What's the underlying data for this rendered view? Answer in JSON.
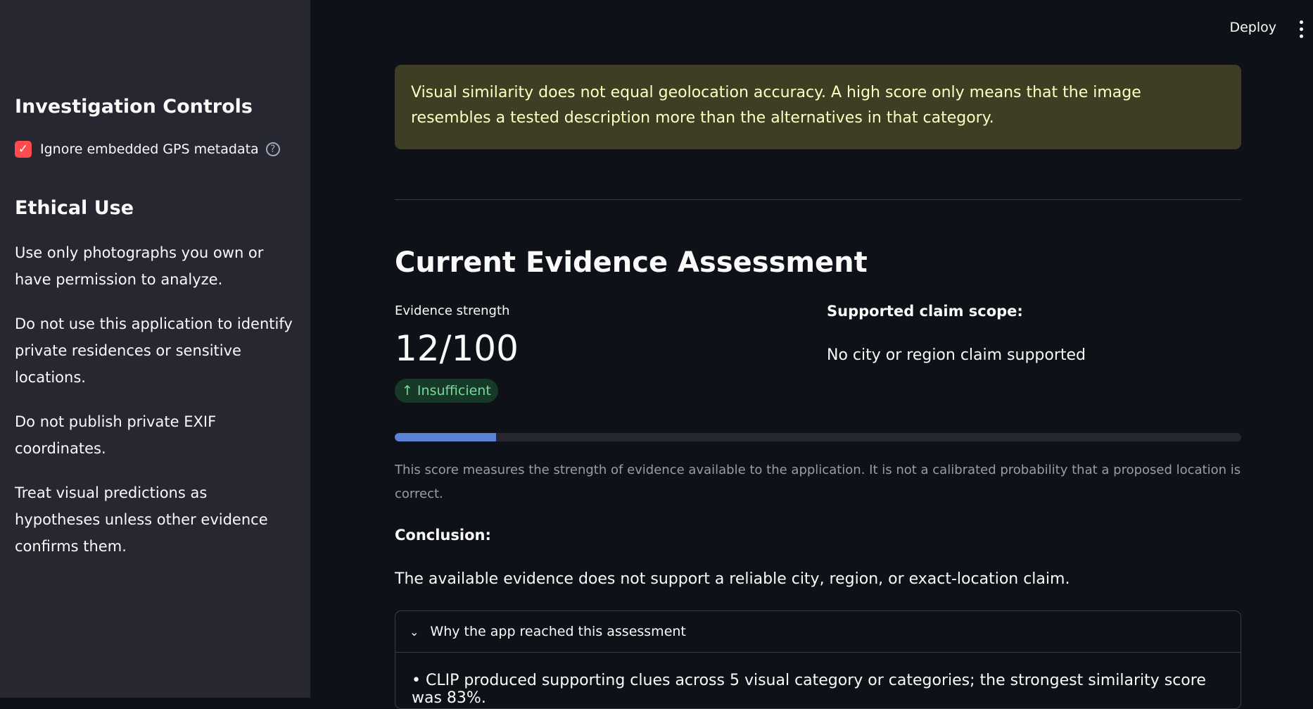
{
  "sidebar": {
    "heading": "Investigation Controls",
    "checkbox_label": "Ignore embedded GPS metadata",
    "checkbox_checked": true,
    "ethics_heading": "Ethical Use",
    "paragraphs": [
      "Use only photographs you own or have permission to analyze.",
      "Do not use this application to identify private residences or sensitive locations.",
      "Do not publish private EXIF coordinates.",
      "Treat visual predictions as hypotheses unless other evidence confirms them."
    ]
  },
  "header": {
    "deploy_label": "Deploy",
    "menu_icon": "kebab-icon"
  },
  "main": {
    "warning": "Visual similarity does not equal geolocation accuracy. A high score only means that the image resembles a tested description more than the alternatives in that category.",
    "section_title": "Current Evidence Assessment",
    "metric_label": "Evidence strength",
    "metric_value": "12/100",
    "metric_delta": "Insufficient",
    "progress_fraction": 0.12,
    "scope_title": "Supported claim scope:",
    "scope_value": "No city or region claim supported",
    "caption": "This score measures the strength of evidence available to the application. It is not a calibrated probability that a proposed location is correct.",
    "conclusion_title": "Conclusion:",
    "conclusion_text": "The available evidence does not support a reliable city, region, or exact-location claim.",
    "expander_title": "Why the app reached this assessment",
    "expander_item": "• CLIP produced supporting clues across 5 visual category or categories; the strongest similarity score was 83%."
  },
  "colors": {
    "accent": "#ff4b4b",
    "progress": "#5b82d6",
    "warning_bg": "#3d3e23",
    "delta_green": "#7cd89a"
  }
}
